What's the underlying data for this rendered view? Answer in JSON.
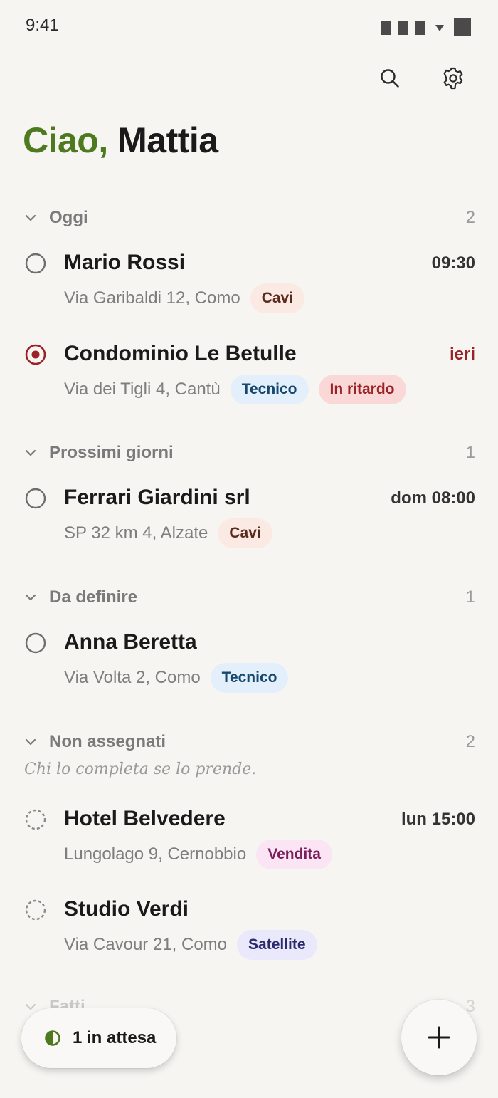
{
  "status_bar": {
    "time": "9:41"
  },
  "header": {
    "greeting": "Ciao,",
    "user_name": "Mattia",
    "icons": [
      "search-icon",
      "gear-icon"
    ]
  },
  "sections": {
    "oggi": {
      "title": "Oggi",
      "count": "2"
    },
    "prossimi": {
      "title": "Prossimi giorni",
      "count": "1"
    },
    "definire": {
      "title": "Da definire",
      "count": "1"
    },
    "non_assegnati": {
      "title": "Non assegnati",
      "count": "2",
      "note": "Chi lo completa se lo prende."
    },
    "fatti": {
      "title": "Fatti",
      "count": "3"
    }
  },
  "tasks": [
    {
      "title": "Mario Rossi",
      "address": "Via Garibaldi 12, Como",
      "time": "09:30",
      "tags": [
        "Cavi"
      ]
    },
    {
      "title": "Condominio Le Betulle",
      "address": "Via dei Tigli 4, Cantù",
      "time": "ieri",
      "tags": [
        "Tecnico",
        "In ritardo"
      ]
    },
    {
      "title": "Ferrari Giardini srl",
      "address": "SP 32 km 4, Alzate",
      "time": "dom 08:00",
      "tags": [
        "Cavi"
      ]
    },
    {
      "title": "Anna Beretta",
      "address": "Via Volta 2, Como",
      "time": "",
      "tags": [
        "Tecnico"
      ]
    },
    {
      "title": "Hotel Belvedere",
      "address": "Lungolago 9, Cernobbio",
      "time": "lun 15:00",
      "tags": [
        "Vendita"
      ]
    },
    {
      "title": "Studio Verdi",
      "address": "Via Cavour 21, Como",
      "time": "",
      "tags": [
        "Satellite"
      ]
    }
  ],
  "pending": {
    "label": "1 in attesa"
  },
  "colors": {
    "accent": "#4e7a1f",
    "late": "#9b2226",
    "background": "#f7f5f2"
  }
}
